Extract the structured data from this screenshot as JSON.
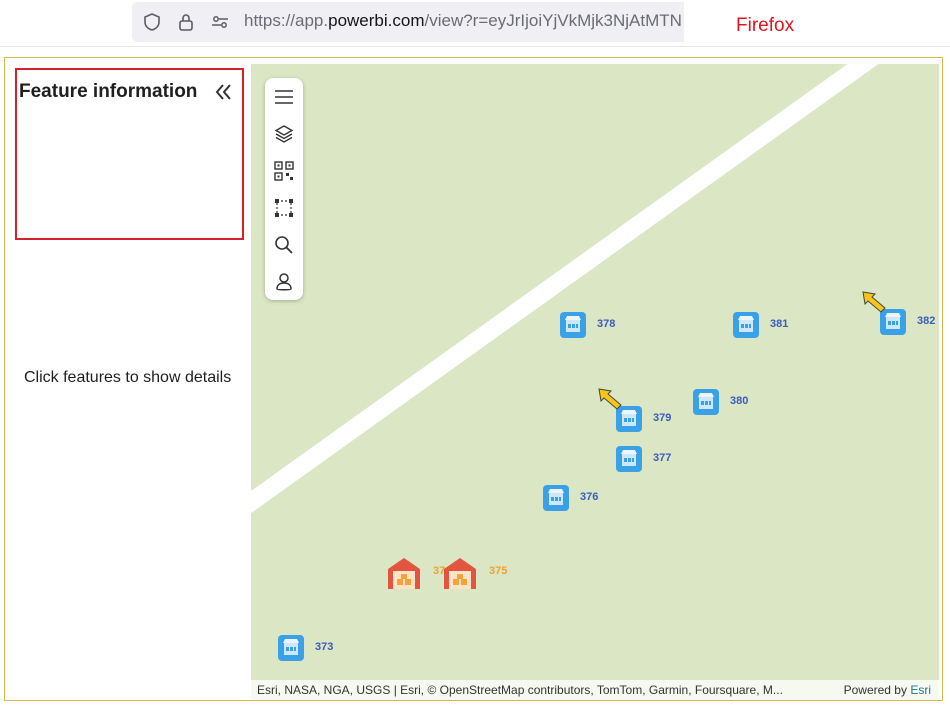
{
  "browser": {
    "url_prefix": "https://app.",
    "url_domain": "powerbi.com",
    "url_rest": "/view?r=eyJrIjoiYjVkMjk3NjAtMTN",
    "name": "Firefox"
  },
  "panel": {
    "title": "Feature information",
    "hint": "Click features to show details"
  },
  "map": {
    "markers": [
      {
        "id": "378",
        "label": "378",
        "type": "store"
      },
      {
        "id": "381",
        "label": "381",
        "type": "store"
      },
      {
        "id": "382",
        "label": "382",
        "type": "store",
        "arrow": true
      },
      {
        "id": "379",
        "label": "379",
        "type": "store",
        "arrow": true
      },
      {
        "id": "380",
        "label": "380",
        "type": "store"
      },
      {
        "id": "377",
        "label": "377",
        "type": "store"
      },
      {
        "id": "376",
        "label": "376",
        "type": "store"
      },
      {
        "id": "374",
        "label": "374",
        "type": "warehouse"
      },
      {
        "id": "375",
        "label": "375",
        "type": "warehouse"
      },
      {
        "id": "373",
        "label": "373",
        "type": "store"
      }
    ],
    "attribution": "Esri, NASA, NGA, USGS | Esri, © OpenStreetMap contributors, TomTom, Garmin, Foursquare, M...",
    "powered_by": "Powered by",
    "powered_brand": "Esri"
  },
  "colors": {
    "map_bg": "#dbe7c4",
    "store_marker": "#3aa0e8",
    "warehouse_marker": "#e2553f",
    "highlight_border": "#d4212b",
    "browser_label": "#e0141e"
  }
}
